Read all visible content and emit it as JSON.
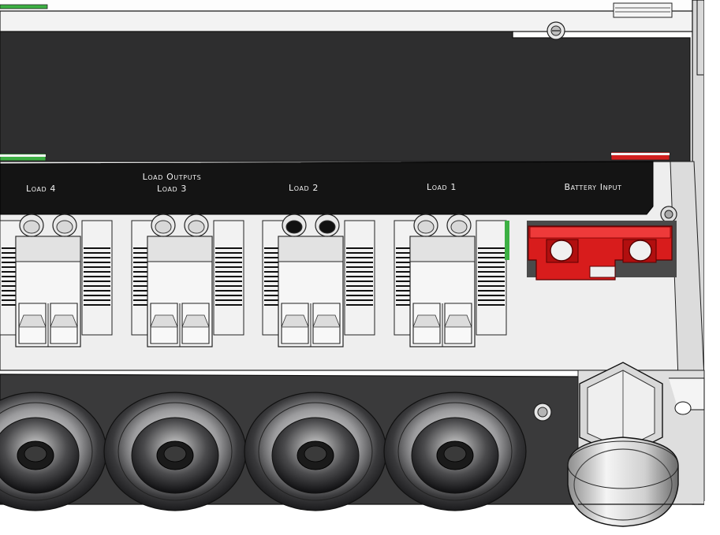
{
  "labels": {
    "load_outputs": "Load Outputs",
    "load4": "Load 4",
    "load3": "Load 3",
    "load2": "Load 2",
    "load1": "Load 1",
    "battery_input": "Battery Input"
  },
  "colors": {
    "housing": "#2e2e2f",
    "label_strip": "#141414",
    "chassis_plate": "#eeeeee",
    "connector_body": "#f4f4f4",
    "battery_connector": "#d81c1c",
    "led_green": "#3cb043",
    "led_red": "#d21e1e"
  },
  "icons": [
    "screw-icon",
    "terminal-block-icon",
    "cable-gland-icon",
    "grommet-icon"
  ]
}
